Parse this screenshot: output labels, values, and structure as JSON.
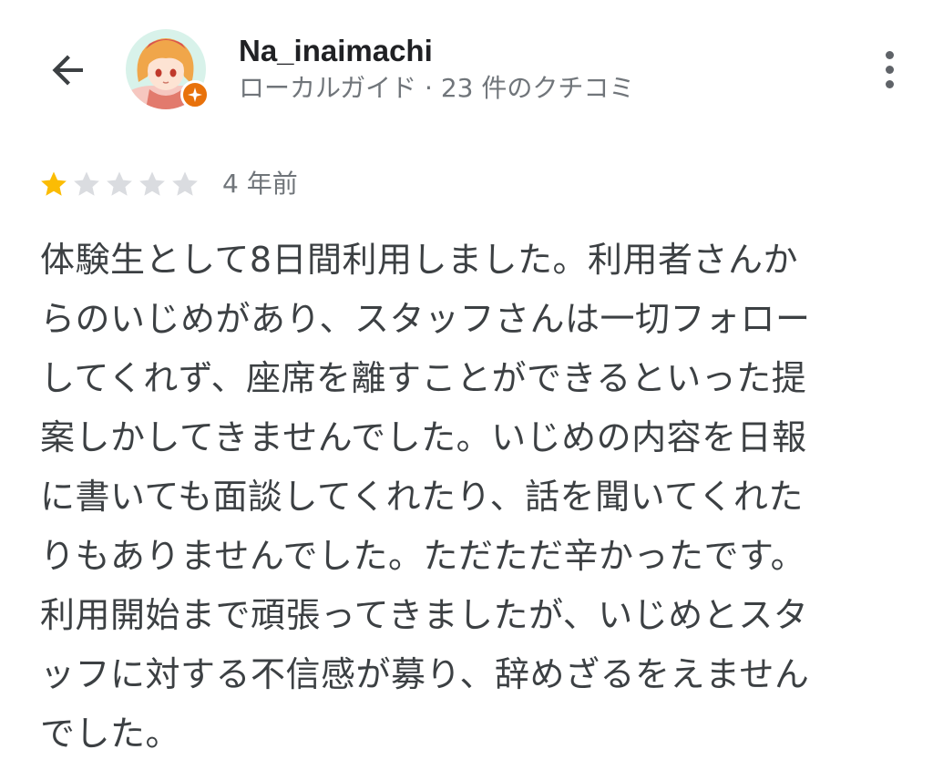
{
  "header": {
    "back_icon": "arrow-left-icon",
    "avatar_icon": "user-avatar-icon",
    "badge_icon": "local-guide-star-icon",
    "user_name": "Na_inaimachi",
    "user_subtitle": "ローカルガイド · 23 件のクチコミ",
    "more_icon": "more-vert-icon"
  },
  "review": {
    "rating": 1,
    "max_rating": 5,
    "time_ago": "4 年前",
    "star_filled_color": "#fbbc04",
    "star_empty_color": "#dadce0",
    "text_lines": [
      "体験生として8日間利用しました。利用者さんか",
      "らのいじめがあり、スタッフさんは一切フォロー",
      "してくれず、座席を離すことができるといった提",
      "案しかしてきませんでした。いじめの内容を日報",
      "に書いても面談してくれたり、話を聞いてくれた",
      "りもありませんでした。ただただ辛かったです。",
      "利用開始まで頑張ってきましたが、いじめとスタ",
      "ッフに対する不信感が募り、辞めざるをえません",
      "でした。"
    ]
  }
}
